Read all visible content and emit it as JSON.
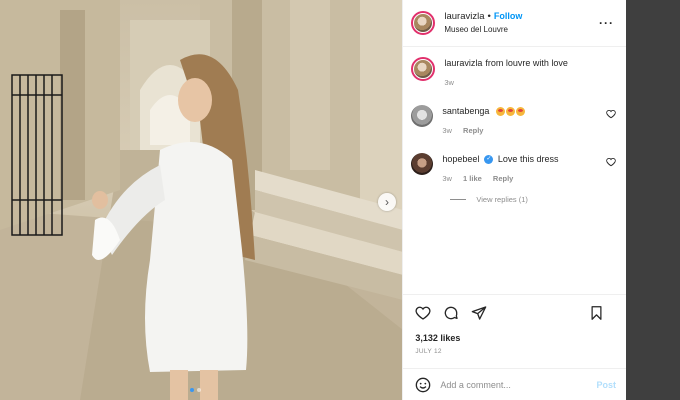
{
  "post": {
    "username": "lauravizla",
    "follow_label": "Follow",
    "location": "Museo del Louvre",
    "caption_text": "from louvre with love",
    "caption_time": "3w",
    "likes": "3,132 likes",
    "date": "JULY 12",
    "photo_index": 1,
    "photo_count": 2
  },
  "comments": [
    {
      "username": "santabenga",
      "text": "",
      "emoji_count": 3,
      "time": "3w",
      "likes": "",
      "reply_label": "Reply"
    },
    {
      "username": "hopebeel",
      "text": "Love this dress",
      "verified": true,
      "time": "3w",
      "likes": "1 like",
      "reply_label": "Reply"
    }
  ],
  "view_replies": "View replies (1)",
  "add_comment": {
    "placeholder": "Add a comment...",
    "post_label": "Post"
  },
  "icons": {
    "more": "more-icon",
    "heart": "heart-icon",
    "comment": "comment-icon",
    "share": "share-icon",
    "save": "bookmark-icon",
    "emoji": "smiley-icon",
    "next": "chevron-right-icon"
  },
  "colors": {
    "link": "#0095f6",
    "muted": "#8e8e8e",
    "story_ring": "#e1306c",
    "post_disabled": "#b2dffc"
  }
}
